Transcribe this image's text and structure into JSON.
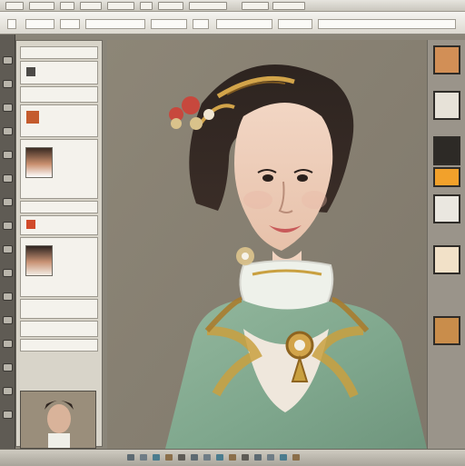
{
  "menubar": {
    "items": [
      "",
      "",
      "",
      "",
      "",
      "",
      "",
      "",
      "",
      ""
    ]
  },
  "options_bar": {
    "fields": [
      "",
      "",
      "",
      "",
      "",
      "",
      "",
      "",
      ""
    ]
  },
  "tools": [
    "move-tool-icon",
    "marquee-tool-icon",
    "lasso-tool-icon",
    "crop-tool-icon",
    "eyedropper-tool-icon",
    "brush-tool-icon",
    "clone-tool-icon",
    "eraser-tool-icon",
    "gradient-tool-icon",
    "dodge-tool-icon",
    "pen-tool-icon",
    "type-tool-icon",
    "path-tool-icon",
    "shape-tool-icon",
    "hand-tool-icon",
    "zoom-tool-icon"
  ],
  "layers_panel": {
    "cards": 7
  },
  "document": {
    "subject": "portrait"
  },
  "right_dock": {
    "thumbs": 7
  },
  "colors": {
    "toolbar_bg": "#e6e4de",
    "panel_bg": "#d8d4c9",
    "canvas_bg": "#877f70",
    "accent_gold": "#c9a040",
    "dress_green": "#8fb89a"
  }
}
